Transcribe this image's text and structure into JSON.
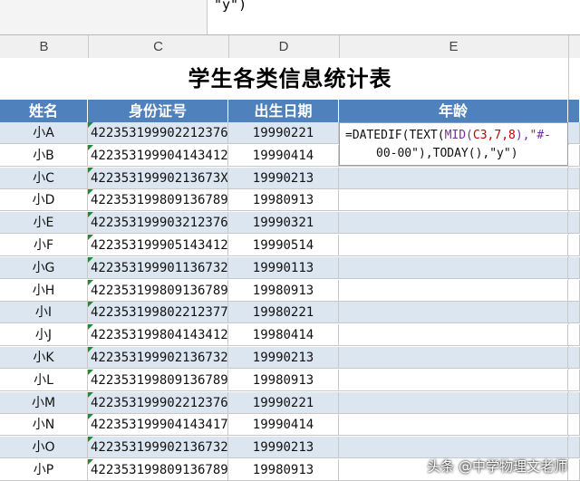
{
  "formula_bar": {
    "visible_tail": "\"y\")"
  },
  "column_headers": [
    "B",
    "C",
    "D",
    "E"
  ],
  "sheet": {
    "title": "学生各类信息统计表",
    "headers": {
      "name": "姓名",
      "id": "身份证号",
      "birth": "出生日期",
      "age": "年龄"
    },
    "rows": [
      {
        "name": "小A",
        "id": "422353199902212376",
        "birth": "19990221"
      },
      {
        "name": "小B",
        "id": "422353199904143412",
        "birth": "19990414"
      },
      {
        "name": "小C",
        "id": "42235319990213673X",
        "birth": "19990213"
      },
      {
        "name": "小D",
        "id": "422353199809136789",
        "birth": "19980913"
      },
      {
        "name": "小E",
        "id": "422353199903212376",
        "birth": "19990321"
      },
      {
        "name": "小F",
        "id": "422353199905143412",
        "birth": "19990514"
      },
      {
        "name": "小G",
        "id": "422353199901136732",
        "birth": "19990113"
      },
      {
        "name": "小H",
        "id": "422353199809136789",
        "birth": "19980913"
      },
      {
        "name": "小I",
        "id": "422353199802212377",
        "birth": "19980221"
      },
      {
        "name": "小J",
        "id": "422353199804143412",
        "birth": "19980414"
      },
      {
        "name": "小K",
        "id": "422353199902136732",
        "birth": "19990213"
      },
      {
        "name": "小L",
        "id": "422353199809136789",
        "birth": "19980913"
      },
      {
        "name": "小M",
        "id": "422353199902212376",
        "birth": "19990221"
      },
      {
        "name": "小N",
        "id": "422353199904143417",
        "birth": "19990414"
      },
      {
        "name": "小O",
        "id": "422353199902136732",
        "birth": "19990213"
      },
      {
        "name": "小P",
        "id": "422353199809136789",
        "birth": "19980913"
      }
    ]
  },
  "editing_formula": {
    "line1_a": "=DATEDIF(TEXT(",
    "line1_b": "MID(",
    "line1_c": "C3,7,8",
    "line1_d": "),\"#-",
    "line2_a": "00-00\"),TODAY(),\"y\")"
  },
  "watermark": "头条 @中学物理文老师",
  "colors": {
    "header_blue": "#4f81bd",
    "band_blue": "#dce6f1",
    "error_triangle": "#1e8a33"
  }
}
